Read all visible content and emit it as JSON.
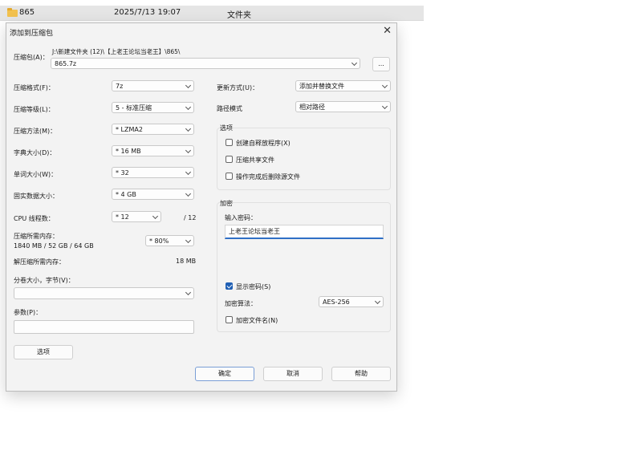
{
  "file_row": {
    "name": "865",
    "date": "2025/7/13 19:07",
    "type": "文件夹"
  },
  "dialog": {
    "title": "添加到压缩包",
    "archive": {
      "label": "压缩包(A)：",
      "path": "J:\\新建文件夹 (12)\\【上老王论坛当老王】\\865\\",
      "value": "865.7z",
      "browse_label": "..."
    },
    "left": {
      "format": {
        "label": "压缩格式(F)：",
        "value": "7z"
      },
      "level": {
        "label": "压缩等级(L)：",
        "value": "5 - 标准压缩"
      },
      "method": {
        "label": "压缩方法(M)：",
        "value": "*  LZMA2"
      },
      "dict": {
        "label": "字典大小(D)：",
        "value": "*  16 MB"
      },
      "word": {
        "label": "单词大小(W)：",
        "value": "*  32"
      },
      "solid": {
        "label": "固实数据大小：",
        "value": "*  4 GB"
      },
      "cpu": {
        "label": "CPU 线程数：",
        "value": "*  12",
        "total": "/ 12"
      },
      "mem_compress": {
        "label": "压缩所需内存：",
        "detail": "1840 MB / 52 GB / 64 GB",
        "value": "*  80%"
      },
      "mem_decompress": {
        "label": "解压缩所需内存：",
        "value": "18 MB"
      },
      "split": {
        "label": "分卷大小，字节(V)：",
        "value": ""
      },
      "params": {
        "label": "参数(P)：",
        "value": ""
      },
      "options_button": "选项"
    },
    "right": {
      "update": {
        "label": "更新方式(U)：",
        "value": "添加并替换文件"
      },
      "path_mode": {
        "label": "路径模式",
        "value": "相对路径"
      },
      "options_group": {
        "title": "选项",
        "items": [
          {
            "label": "创建自释放程序(X)",
            "checked": false
          },
          {
            "label": "压缩共享文件",
            "checked": false
          },
          {
            "label": "操作完成后删除源文件",
            "checked": false
          }
        ]
      },
      "encryption": {
        "title": "加密",
        "password_label": "输入密码：",
        "password_value": "上老王论坛当老王",
        "show_password": {
          "label": "显示密码(S)",
          "checked": true
        },
        "method_label": "加密算法：",
        "method_value": "AES-256",
        "encrypt_names": {
          "label": "加密文件名(N)",
          "checked": false
        }
      }
    },
    "buttons": {
      "ok": "确定",
      "cancel": "取消",
      "help": "帮助"
    }
  }
}
